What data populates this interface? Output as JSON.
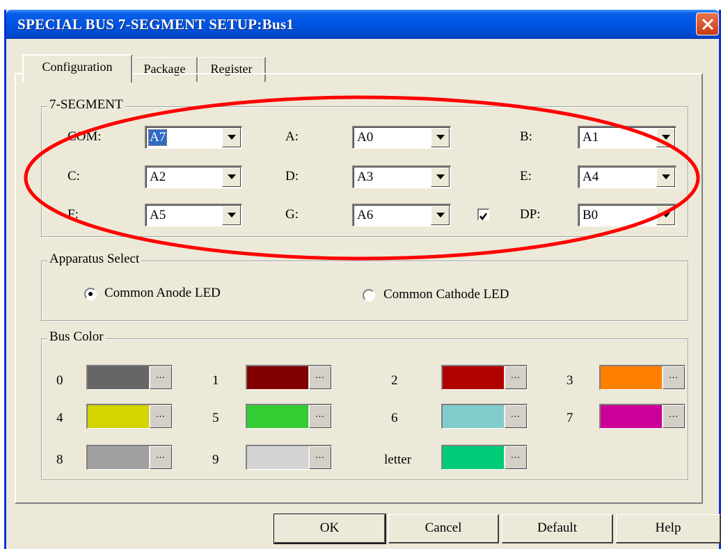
{
  "window": {
    "title": "SPECIAL BUS 7-SEGMENT SETUP:Bus1"
  },
  "tabs": [
    {
      "label": "Configuration",
      "active": true
    },
    {
      "label": "Package",
      "active": false
    },
    {
      "label": "Register",
      "active": false
    }
  ],
  "segment": {
    "legend": "7-SEGMENT",
    "rows": [
      [
        {
          "label": "COM:",
          "value": "A7",
          "selected": true
        },
        {
          "label": "A:",
          "value": "A0"
        },
        {
          "label": "B:",
          "value": "A1"
        }
      ],
      [
        {
          "label": "C:",
          "value": "A2"
        },
        {
          "label": "D:",
          "value": "A3"
        },
        {
          "label": "E:",
          "value": "A4"
        }
      ],
      [
        {
          "label": "F:",
          "value": "A5"
        },
        {
          "label": "G:",
          "value": "A6"
        },
        {
          "label": "DP:",
          "value": "B0"
        }
      ]
    ],
    "dp_checked": true
  },
  "apparatus": {
    "legend": "Apparatus Select",
    "options": [
      {
        "label": "Common Anode LED",
        "selected": true
      },
      {
        "label": "Common Cathode LED",
        "selected": false
      }
    ]
  },
  "bus_color": {
    "legend": "Bus Color",
    "swatches": [
      {
        "label": "0",
        "color": "#666666"
      },
      {
        "label": "1",
        "color": "#800000"
      },
      {
        "label": "2",
        "color": "#b00000"
      },
      {
        "label": "3",
        "color": "#ff8000"
      },
      {
        "label": "4",
        "color": "#d4d400"
      },
      {
        "label": "5",
        "color": "#33cc33"
      },
      {
        "label": "6",
        "color": "#80cccc"
      },
      {
        "label": "7",
        "color": "#cc0099"
      },
      {
        "label": "8",
        "color": "#a0a0a0"
      },
      {
        "label": "9",
        "color": "#d4d4d4"
      },
      {
        "label": "letter",
        "color": "#00cc77"
      }
    ],
    "more_label": "..."
  },
  "buttons": {
    "ok": "OK",
    "cancel": "Cancel",
    "default": "Default",
    "help": "Help"
  },
  "colors": {
    "annotation": "#ff0000",
    "title_bar": "#0054e3"
  }
}
